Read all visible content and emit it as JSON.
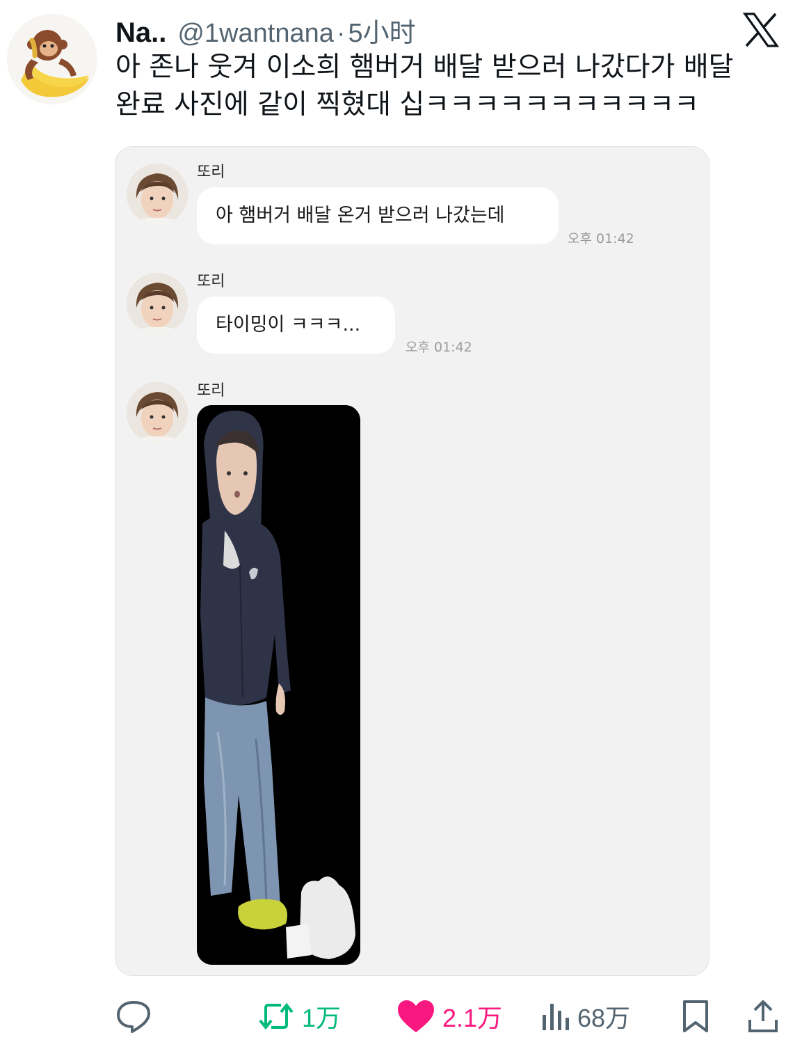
{
  "tweet": {
    "display_name": "Na..",
    "handle": "@1wantnana",
    "separator": "·",
    "time": "5小时",
    "text_lines": [
      "아 존나 웃겨 이소희 햄버거 배달 받으러 나갔다가 배달",
      "완료 사진에 같이 찍혔대 십ㅋㅋㅋㅋㅋㅋㅋㅋㅋㅋㅋ"
    ]
  },
  "chat": {
    "messages": [
      {
        "sender": "또리",
        "text": "아 햄버거 배달 온거 받으러 나갔는데",
        "time": "오후 01:42"
      },
      {
        "sender": "또리",
        "text": "타이밍이 ㅋㅋㅋ...",
        "time": "오후 01:42"
      },
      {
        "sender": "또리",
        "type": "photo"
      }
    ]
  },
  "actions": {
    "reply": {
      "icon": "reply-icon",
      "count": ""
    },
    "retweet": {
      "icon": "retweet-icon",
      "count": "1万",
      "color": "#00ba7c"
    },
    "like": {
      "icon": "heart-icon",
      "count": "2.1万",
      "color": "#f91880"
    },
    "views": {
      "icon": "views-icon",
      "count": "68万"
    },
    "bookmark": {
      "icon": "bookmark-icon"
    },
    "share": {
      "icon": "share-icon"
    }
  },
  "colors": {
    "text": "#0f1419",
    "secondary": "#536471",
    "card_bg": "#f2f2f2"
  }
}
